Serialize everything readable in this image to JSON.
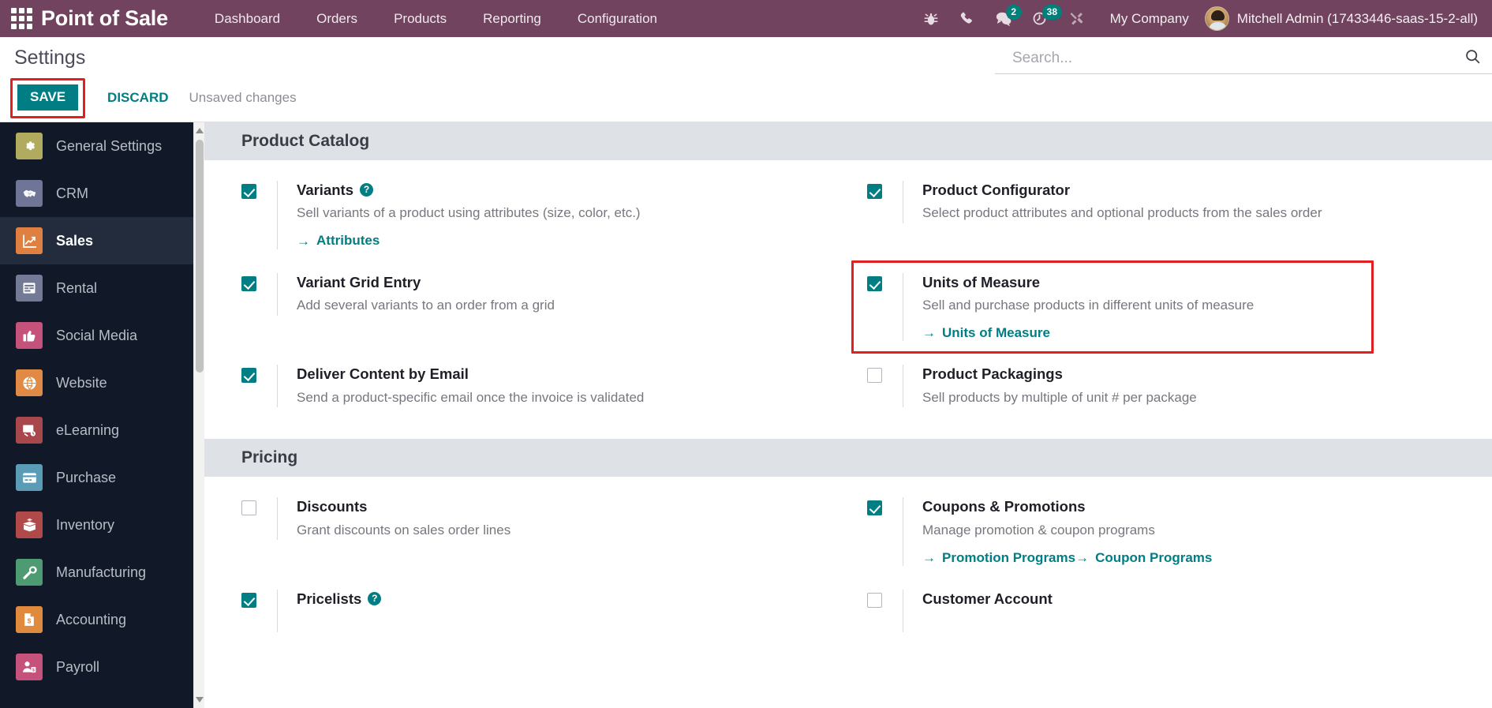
{
  "navbar": {
    "apps_icon": "apps-grid-icon",
    "brand": "Point of Sale",
    "menu": [
      {
        "label": "Dashboard"
      },
      {
        "label": "Orders"
      },
      {
        "label": "Products"
      },
      {
        "label": "Reporting"
      },
      {
        "label": "Configuration"
      }
    ],
    "icons": [
      {
        "name": "bug-icon",
        "badge": null
      },
      {
        "name": "phone-icon",
        "badge": null
      },
      {
        "name": "messages-icon",
        "badge": "2"
      },
      {
        "name": "activities-clock-icon",
        "badge": "38"
      },
      {
        "name": "tools-wrench-icon",
        "badge": null
      }
    ],
    "company": "My Company",
    "user": "Mitchell Admin (17433446-saas-15-2-all)",
    "accent_badge_color": "#00807b",
    "background_color": "#71435f"
  },
  "control_panel": {
    "title": "Settings",
    "save_label": "SAVE",
    "discard_label": "DISCARD",
    "status": "Unsaved changes",
    "highlight_color": "#e32020",
    "save_color": "#017e84"
  },
  "search": {
    "placeholder": "Search...",
    "value": "",
    "icon": "search-icon"
  },
  "sidebar": {
    "items": [
      {
        "label": "General Settings",
        "icon": "gear-icon",
        "color": "#b0ab5e",
        "active": false
      },
      {
        "label": "CRM",
        "icon": "handshake-icon",
        "color": "#6f7596",
        "active": false
      },
      {
        "label": "Sales",
        "icon": "chart-line-icon",
        "color": "#e08040",
        "active": true
      },
      {
        "label": "Rental",
        "icon": "calendar-grid-icon",
        "color": "#727a96",
        "active": false
      },
      {
        "label": "Social Media",
        "icon": "thumbs-up-icon",
        "color": "#c4527b",
        "active": false
      },
      {
        "label": "Website",
        "icon": "globe-icon",
        "color": "#e08a45",
        "active": false
      },
      {
        "label": "eLearning",
        "icon": "presentation-icon",
        "color": "#a8484c",
        "active": false
      },
      {
        "label": "Purchase",
        "icon": "credit-card-icon",
        "color": "#5a9bb5",
        "active": false
      },
      {
        "label": "Inventory",
        "icon": "box-open-icon",
        "color": "#b04a4a",
        "active": false
      },
      {
        "label": "Manufacturing",
        "icon": "wrench-icon",
        "color": "#4e9a72",
        "active": false
      },
      {
        "label": "Accounting",
        "icon": "invoice-dollar-icon",
        "color": "#e08a3d",
        "active": false
      },
      {
        "label": "Payroll",
        "icon": "user-money-icon",
        "color": "#c4527b",
        "active": false
      }
    ]
  },
  "sections": [
    {
      "title": "Product Catalog",
      "rows": [
        {
          "checked": true,
          "title": "Variants",
          "has_help": true,
          "desc": "Sell variants of a product using attributes (size, color, etc.)",
          "links": [
            "Attributes"
          ],
          "highlighted": false
        },
        {
          "checked": true,
          "title": "Product Configurator",
          "has_help": false,
          "desc": "Select product attributes and optional products from the sales order",
          "links": [],
          "highlighted": false
        },
        {
          "checked": true,
          "title": "Variant Grid Entry",
          "has_help": false,
          "desc": "Add several variants to an order from a grid",
          "links": [],
          "highlighted": false
        },
        {
          "checked": true,
          "title": "Units of Measure",
          "has_help": false,
          "desc": "Sell and purchase products in different units of measure",
          "links": [
            "Units of Measure"
          ],
          "highlighted": true
        },
        {
          "checked": true,
          "title": "Deliver Content by Email",
          "has_help": false,
          "desc": "Send a product-specific email once the invoice is validated",
          "links": [],
          "highlighted": false
        },
        {
          "checked": false,
          "title": "Product Packagings",
          "has_help": false,
          "desc": "Sell products by multiple of unit # per package",
          "links": [],
          "highlighted": false
        }
      ]
    },
    {
      "title": "Pricing",
      "rows": [
        {
          "checked": false,
          "title": "Discounts",
          "has_help": false,
          "desc": "Grant discounts on sales order lines",
          "links": [],
          "highlighted": false
        },
        {
          "checked": true,
          "title": "Coupons & Promotions",
          "has_help": false,
          "desc": "Manage promotion & coupon programs",
          "links": [
            "Promotion Programs",
            "Coupon Programs"
          ],
          "highlighted": false
        },
        {
          "checked": true,
          "title": "Pricelists",
          "has_help": true,
          "desc": "",
          "links": [],
          "highlighted": false
        },
        {
          "checked": false,
          "title": "Customer Account",
          "has_help": false,
          "desc": "",
          "links": [],
          "highlighted": false
        }
      ]
    }
  ]
}
